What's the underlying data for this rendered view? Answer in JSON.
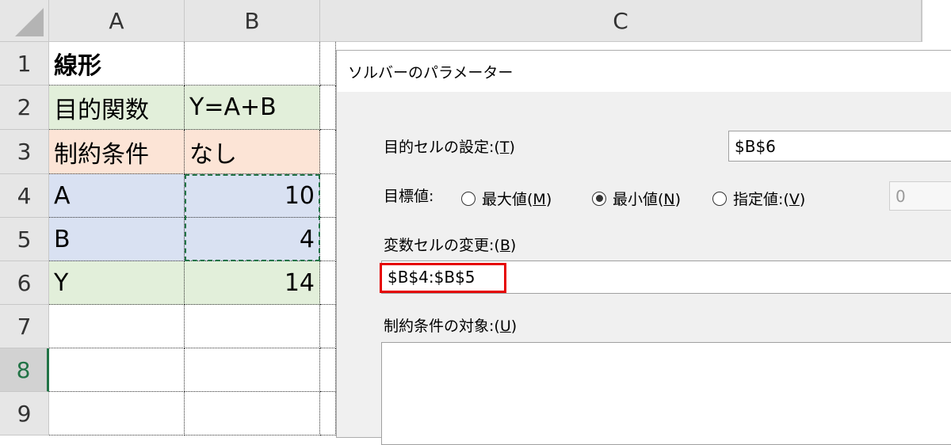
{
  "sheet": {
    "columns": [
      "A",
      "B",
      "C"
    ],
    "rows": [
      "1",
      "2",
      "3",
      "4",
      "5",
      "6",
      "7",
      "8",
      "9"
    ],
    "selected_row": "8",
    "cells": {
      "A1": "線形",
      "A2": "目的関数",
      "B2": "Y=A+B",
      "A3": "制約条件",
      "B3": "なし",
      "A4": "A",
      "B4": "10",
      "A5": "B",
      "B5": "4",
      "A6": "Y",
      "B6": "14"
    },
    "colors": {
      "green": "#e2efda",
      "salmon": "#fce4d6",
      "blue": "#d9e1f2",
      "excel_green": "#217346"
    }
  },
  "dialog": {
    "title": "ソルバーのパラメーター",
    "objective": {
      "label": "目的セルの設定:(",
      "key": "T",
      "label_end": ")",
      "value": "$B$6"
    },
    "goal": {
      "label": "目標値:",
      "options": [
        {
          "label": "最大値(",
          "key": "M",
          "end": ")",
          "selected": false
        },
        {
          "label": "最小値(",
          "key": "N",
          "end": ")",
          "selected": true
        },
        {
          "label": "指定値:(",
          "key": "V",
          "end": ")",
          "selected": false
        }
      ],
      "value_of": "0"
    },
    "variables": {
      "label": "変数セルの変更:(",
      "key": "B",
      "label_end": ")",
      "value": "$B$4:$B$5"
    },
    "constraints": {
      "label": "制約条件の対象:(",
      "key": "U",
      "label_end": ")"
    },
    "highlight_color": "#e60000"
  }
}
